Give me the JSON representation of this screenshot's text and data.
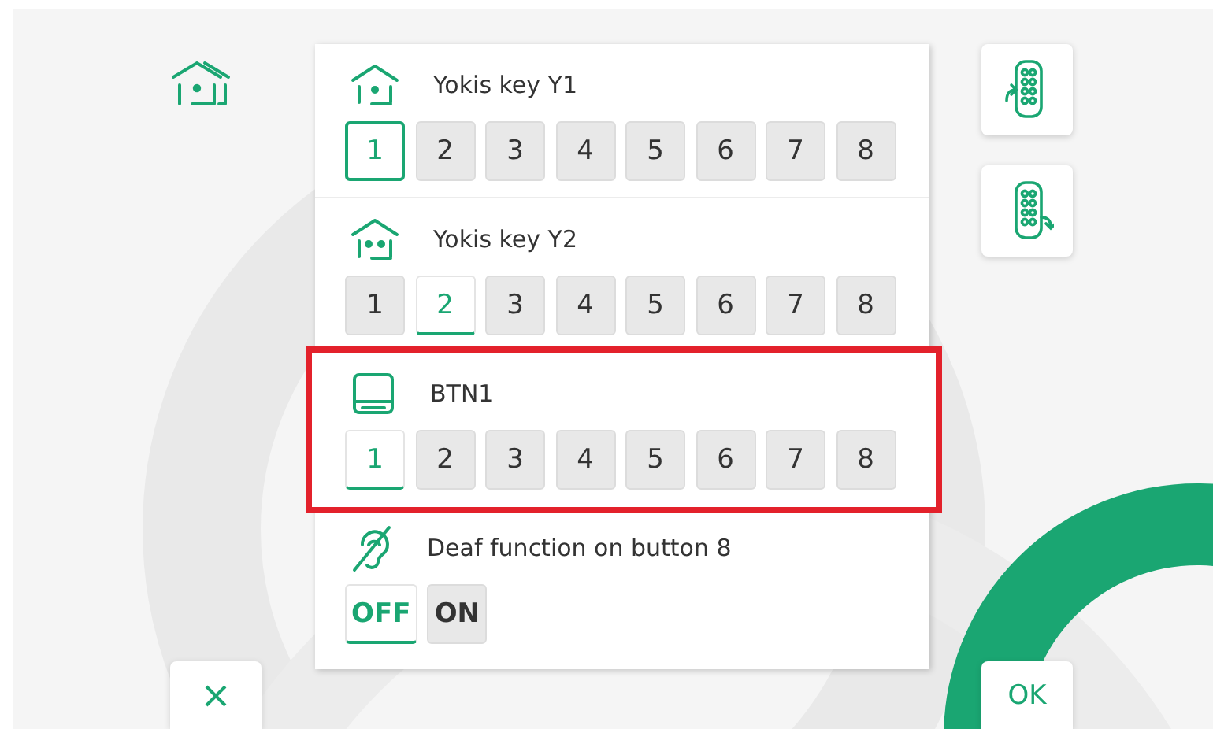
{
  "rows": [
    {
      "kind": "key-single",
      "title": "Yokis key Y1",
      "focused": true,
      "highlighted": false,
      "options": [
        {
          "label": "1",
          "selected": true
        },
        {
          "label": "2",
          "selected": false
        },
        {
          "label": "3",
          "selected": false
        },
        {
          "label": "4",
          "selected": false
        },
        {
          "label": "5",
          "selected": false
        },
        {
          "label": "6",
          "selected": false
        },
        {
          "label": "7",
          "selected": false
        },
        {
          "label": "8",
          "selected": false
        }
      ]
    },
    {
      "kind": "key-double",
      "title": "Yokis key Y2",
      "focused": false,
      "highlighted": false,
      "options": [
        {
          "label": "1",
          "selected": false
        },
        {
          "label": "2",
          "selected": true
        },
        {
          "label": "3",
          "selected": false
        },
        {
          "label": "4",
          "selected": false
        },
        {
          "label": "5",
          "selected": false
        },
        {
          "label": "6",
          "selected": false
        },
        {
          "label": "7",
          "selected": false
        },
        {
          "label": "8",
          "selected": false
        }
      ]
    },
    {
      "kind": "button",
      "title": "BTN1",
      "focused": false,
      "highlighted": true,
      "options": [
        {
          "label": "1",
          "selected": true
        },
        {
          "label": "2",
          "selected": false
        },
        {
          "label": "3",
          "selected": false
        },
        {
          "label": "4",
          "selected": false
        },
        {
          "label": "5",
          "selected": false
        },
        {
          "label": "6",
          "selected": false
        },
        {
          "label": "7",
          "selected": false
        },
        {
          "label": "8",
          "selected": false
        }
      ]
    },
    {
      "kind": "deaf",
      "title": "Deaf function on button 8",
      "focused": false,
      "highlighted": false,
      "options": [
        {
          "label": "OFF",
          "selected": true
        },
        {
          "label": "ON",
          "selected": false
        }
      ]
    }
  ],
  "ok_button": "OK"
}
